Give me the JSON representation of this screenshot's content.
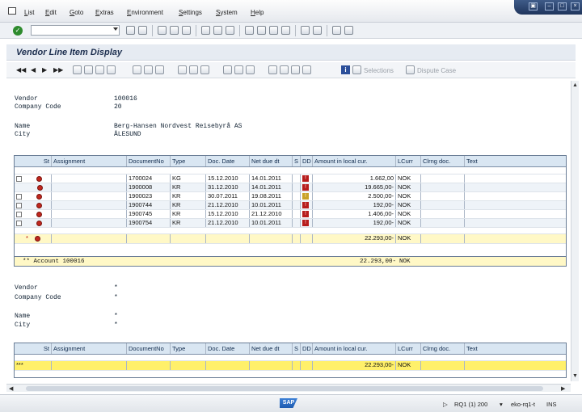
{
  "menu": {
    "items": [
      "List",
      "Edit",
      "Goto",
      "Extras",
      "Environment",
      "Settings",
      "System",
      "Help"
    ]
  },
  "command": {
    "value": ""
  },
  "title": "Vendor Line Item Display",
  "app_toolbar": {
    "selections": "Selections",
    "dispute_case": "Dispute Case"
  },
  "header1": {
    "vendor_label": "Vendor",
    "vendor_value": "100016",
    "company_label": "Company Code",
    "company_value": "20",
    "name_label": "Name",
    "name_value": "Berg-Hansen Nordvest Reisebyrå AS",
    "city_label": "City",
    "city_value": "ÅLESUND"
  },
  "columns": [
    "St",
    "Assignment",
    "DocumentNo",
    "Type",
    "Doc. Date",
    "Net due dt",
    "S",
    "DD",
    "Amount in local cur.",
    "LCurr",
    "Clrng doc.",
    "Text"
  ],
  "rows": [
    {
      "doc": "1700024",
      "type": "KG",
      "doc_date": "15.12.2010",
      "due": "14.01.2011",
      "amount": "1.662,00",
      "curr": "NOK"
    },
    {
      "doc": "1900008",
      "type": "KR",
      "doc_date": "31.12.2010",
      "due": "14.01.2011",
      "amount": "19.665,00-",
      "curr": "NOK"
    },
    {
      "doc": "1900023",
      "type": "KR",
      "doc_date": "30.07.2011",
      "due": "19.08.2011",
      "amount": "2.500,00-",
      "curr": "NOK"
    },
    {
      "doc": "1900744",
      "type": "KR",
      "doc_date": "21.12.2010",
      "due": "10.01.2011",
      "amount": "192,00-",
      "curr": "NOK"
    },
    {
      "doc": "1900745",
      "type": "KR",
      "doc_date": "15.12.2010",
      "due": "21.12.2010",
      "amount": "1.406,00-",
      "curr": "NOK"
    },
    {
      "doc": "1900754",
      "type": "KR",
      "doc_date": "21.12.2010",
      "due": "10.01.2011",
      "amount": "192,00-",
      "curr": "NOK"
    }
  ],
  "subtotal": {
    "marker": "*",
    "amount": "22.293,00-",
    "curr": "NOK"
  },
  "account_total": {
    "label": "** Account 100016",
    "amount": "22.293,00-",
    "curr": "NOK"
  },
  "header2": {
    "vendor_label": "Vendor",
    "vendor_value": "*",
    "company_label": "Company Code",
    "company_value": "*",
    "name_label": "Name",
    "name_value": "*",
    "city_label": "City",
    "city_value": "*"
  },
  "grand_total": {
    "marker": "***",
    "amount": "22.293,00-",
    "curr": "NOK"
  },
  "status": {
    "system": "RQ1 (1) 200",
    "server": "eko-rq1-t",
    "mode": "INS"
  },
  "colors": {
    "status_red": "#c0271e",
    "subtotal_yellow": "#fff8c6",
    "total_yellow": "#fff06a",
    "header_blue": "#d9e6f2"
  }
}
